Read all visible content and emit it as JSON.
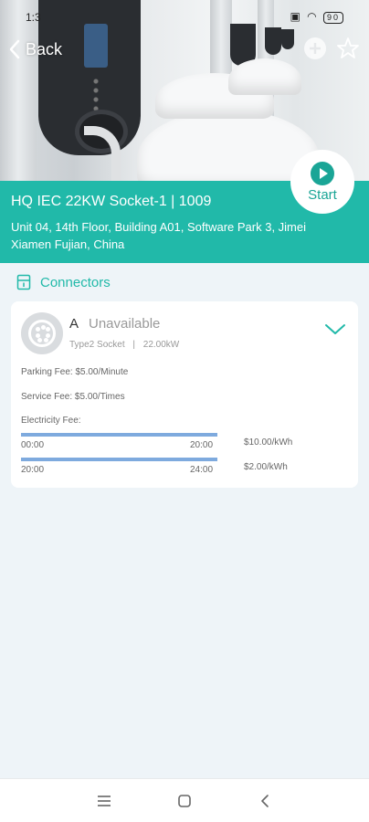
{
  "status_bar": {
    "time": "1:3",
    "battery": "90"
  },
  "header": {
    "back_label": "Back"
  },
  "station": {
    "title": "HQ IEC 22KW Socket-1 | 1009",
    "address": "Unit 04, 14th Floor, Building A01, Software Park 3, Jimei Xiamen Fujian, China",
    "start_label": "Start"
  },
  "connectors_section": {
    "title": "Connectors"
  },
  "connector": {
    "name": "A",
    "status": "Unavailable",
    "socket_type": "Type2 Socket",
    "separator": "|",
    "power": "22.00kW",
    "parking_fee": "Parking Fee: $5.00/Minute",
    "service_fee": "Service Fee: $5.00/Times",
    "electricity_fee_label": "Electricity Fee:",
    "tariffs": [
      {
        "start": "00:00",
        "end": "20:00",
        "price": "$10.00/kWh"
      },
      {
        "start": "20:00",
        "end": "24:00",
        "price": "$2.00/kWh"
      }
    ]
  },
  "colors": {
    "accent": "#21b9a9",
    "bar": "#7eaade"
  },
  "icons": {
    "back": "chevron-left-icon",
    "add": "add-circle-icon",
    "favorite": "star-icon",
    "start": "play-icon",
    "connectors": "connector-icon",
    "expand": "chevron-down-icon",
    "nav_menu": "menu-icon",
    "nav_home": "home-square-icon",
    "nav_back": "nav-back-icon"
  }
}
